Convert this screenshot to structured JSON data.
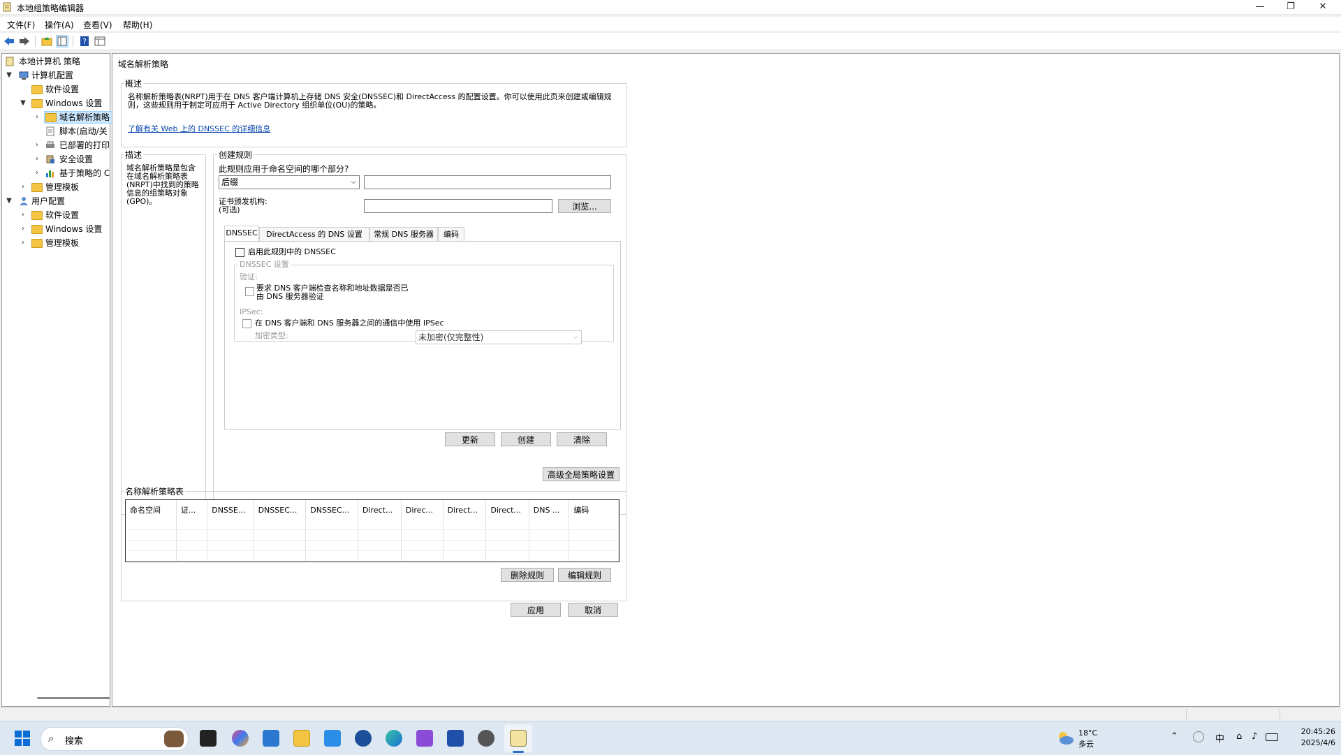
{
  "window": {
    "title": "本地组策略编辑器",
    "min": "—",
    "max": "❐",
    "close": "✕"
  },
  "menu": [
    "文件(F)",
    "操作(A)",
    "查看(V)",
    "帮助(H)"
  ],
  "tree": {
    "root": "本地计算机 策略",
    "computer_config": "计算机配置",
    "software_settings": "软件设置",
    "windows_settings": "Windows 设置",
    "nrpt": "域名解析策略",
    "scripts": "脚本(启动/关",
    "printers": "已部署的打印",
    "security": "安全设置",
    "policy_qos": "基于策略的 C",
    "admin_templates": "管理模板",
    "user_config": "用户配置",
    "user_software": "软件设置",
    "user_windows": "Windows 设置",
    "user_admin": "管理模板"
  },
  "content": {
    "heading": "域名解析策略",
    "overview_title": "概述",
    "overview_text": "名称解析策略表(NRPT)用于在 DNS 客户端计算机上存储 DNS 安全(DNSSEC)和 DirectAccess 的配置设置。你可以使用此页来创建或编辑规则，这些规则用于制定可应用于 Active Directory 组织单位(OU)的策略。",
    "overview_link": "了解有关 Web 上的 DNSSEC 的详细信息",
    "desc_title": "描述",
    "desc_text": "域名解析策略是包含在域名解析策略表(NRPT)中找到的策略信息的组策略对象(GPO)。",
    "create_title": "创建规则",
    "apply_question": "此规则应用于命名空间的哪个部分?",
    "suffix_value": "后缀",
    "ca_label": "证书颁发机构:",
    "ca_optional": "(可选)",
    "browse": "浏览...",
    "tabs": [
      "DNSSEC",
      "DirectAccess 的 DNS 设置",
      "常规 DNS 服务器",
      "编码"
    ],
    "enable_dnssec": "启用此规则中的 DNSSEC",
    "dnssec_settings": "DNSSEC 设置",
    "validation": "验证:",
    "require_validation_1": "要求 DNS 客户端检查名称和地址数据是否已",
    "require_validation_2": "由 DNS 服务器验证",
    "ipsec": "IPSec:",
    "use_ipsec": "在 DNS 客户端和 DNS 服务器之间的通信中使用 IPSec",
    "encryption_type": "加密类型:",
    "encryption_value": "未加密(仅完整性)",
    "update": "更新",
    "create": "创建",
    "clear": "清除",
    "advanced": "高级全局策略设置",
    "table_title": "名称解析策略表",
    "columns": [
      "命名空间",
      "证...",
      "DNSSE...",
      "DNSSEC...",
      "DNSSEC...",
      "Direct...",
      "Direc...",
      "Direct...",
      "Direct...",
      "DNS ...",
      "编码"
    ],
    "delete_rule": "删除规则",
    "edit_rule": "编辑规则",
    "apply": "应用",
    "cancel": "取消"
  },
  "taskbar": {
    "search": "搜索",
    "weather_temp": "18°C",
    "weather_desc": "多云",
    "ime": "中",
    "time": "20:45:26",
    "date": "2025/4/6"
  }
}
